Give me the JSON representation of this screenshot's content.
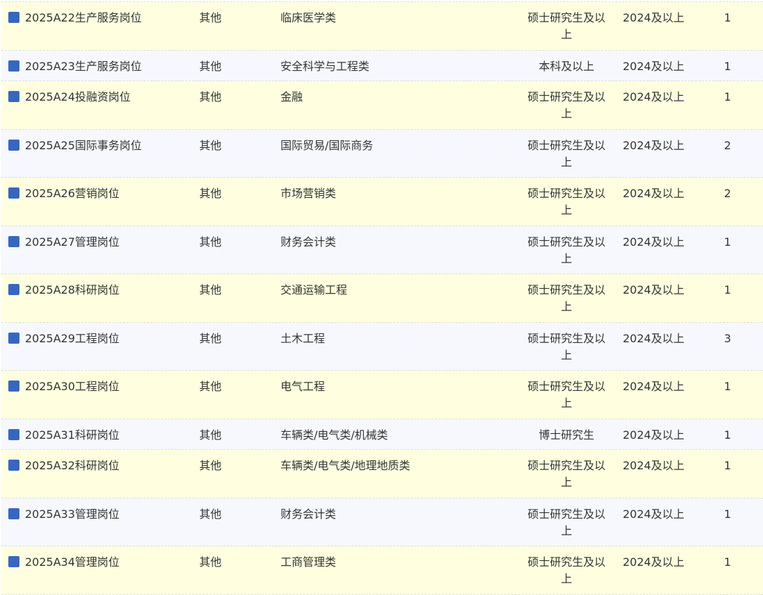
{
  "rows": [
    {
      "title": "2025A22生产服务岗位",
      "type": "其他",
      "major": "临床医学类",
      "education": "硕士研究生及以上",
      "year": "2024及以上",
      "count": "1"
    },
    {
      "title": "2025A23生产服务岗位",
      "type": "其他",
      "major": "安全科学与工程类",
      "education": "本科及以上",
      "year": "2024及以上",
      "count": "1"
    },
    {
      "title": "2025A24投融资岗位",
      "type": "其他",
      "major": "金融",
      "education": "硕士研究生及以上",
      "year": "2024及以上",
      "count": "1"
    },
    {
      "title": "2025A25国际事务岗位",
      "type": "其他",
      "major": "国际贸易/国际商务",
      "education": "硕士研究生及以上",
      "year": "2024及以上",
      "count": "2"
    },
    {
      "title": "2025A26营销岗位",
      "type": "其他",
      "major": "市场营销类",
      "education": "硕士研究生及以上",
      "year": "2024及以上",
      "count": "2"
    },
    {
      "title": "2025A27管理岗位",
      "type": "其他",
      "major": "财务会计类",
      "education": "硕士研究生及以上",
      "year": "2024及以上",
      "count": "1"
    },
    {
      "title": "2025A28科研岗位",
      "type": "其他",
      "major": "交通运输工程",
      "education": "硕士研究生及以上",
      "year": "2024及以上",
      "count": "1"
    },
    {
      "title": "2025A29工程岗位",
      "type": "其他",
      "major": "土木工程",
      "education": "硕士研究生及以上",
      "year": "2024及以上",
      "count": "3"
    },
    {
      "title": "2025A30工程岗位",
      "type": "其他",
      "major": "电气工程",
      "education": "硕士研究生及以上",
      "year": "2024及以上",
      "count": "1"
    },
    {
      "title": "2025A31科研岗位",
      "type": "其他",
      "major": "车辆类/电气类/机械类",
      "education": "博士研究生",
      "year": "2024及以上",
      "count": "1"
    },
    {
      "title": "2025A32科研岗位",
      "type": "其他",
      "major": "车辆类/电气类/地理地质类",
      "education": "硕士研究生及以上",
      "year": "2024及以上",
      "count": "1"
    },
    {
      "title": "2025A33管理岗位",
      "type": "其他",
      "major": "财务会计类",
      "education": "硕士研究生及以上",
      "year": "2024及以上",
      "count": "1"
    },
    {
      "title": "2025A34管理岗位",
      "type": "其他",
      "major": "工商管理类",
      "education": "硕士研究生及以上",
      "year": "2024及以上",
      "count": "1"
    }
  ],
  "colors": {
    "marker": "#3567c2",
    "row_odd": "#ffffe0",
    "row_even": "#f6f8fd"
  },
  "icons": {
    "row_marker": "square-bullet-icon"
  }
}
